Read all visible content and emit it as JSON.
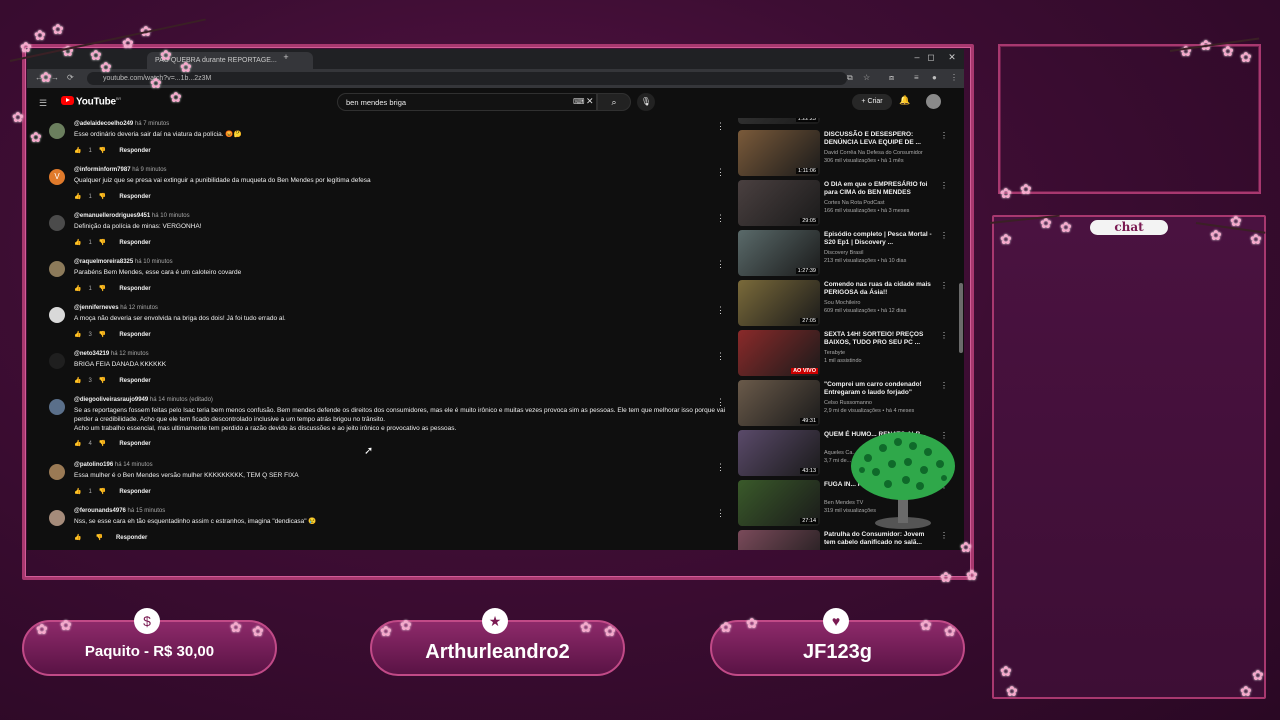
{
  "browser": {
    "tabs": [
      {
        "label": "PAU QUEBRA durante REPORTAGE..."
      }
    ],
    "new_tab": "+",
    "url": "youtube.com/watch?v=...1b...2z3M",
    "window_controls": [
      "–",
      "◻",
      "✕"
    ]
  },
  "youtube": {
    "logo": "YouTube",
    "logo_sup": "BR",
    "search_value": "ben mendes briga",
    "create_label": "Criar"
  },
  "comments": [
    {
      "user": "@adelaidecoelho249",
      "time": "há 7 minutos",
      "text": "Esse ordinário deveria sair daí na viatura da polícia. 😡🤔",
      "likes": "1",
      "avatar_color": "#6b7f5e"
    },
    {
      "user": "@informinform7987",
      "time": "há 9 minutos",
      "text": "Qualquer juiz que se presa vai extinguir a punibilidade da muqueta do Ben Mendes por legítima defesa",
      "likes": "1",
      "avatar_color": "#e07a2b",
      "avatar_letter": "V"
    },
    {
      "user": "@emanuellerodrigues9451",
      "time": "há 10 minutos",
      "text": "Definição da polícia de minas: VERGONHA!",
      "likes": "1",
      "avatar_color": "#4b4b4b"
    },
    {
      "user": "@raquelmoreira8325",
      "time": "há 10 minutos",
      "text": "Parabéns Bem Mendes, esse cara é um caloteiro covarde",
      "likes": "1",
      "avatar_color": "#8c7a5a"
    },
    {
      "user": "@jenniferneves",
      "time": "há 12 minutos",
      "text": "A moça não deveria ser envolvida na briga dos dois! Já foi tudo errado al.",
      "likes": "3",
      "avatar_color": "#d9d9d9"
    },
    {
      "user": "@neto34219",
      "time": "há 12 minutos",
      "text": "BRIGA FEIA DANADA KKKKKK",
      "likes": "3",
      "avatar_color": "#1f1f1f"
    },
    {
      "user": "@diegooliveirasraujo9949",
      "time": "há 14 minutos (editado)",
      "text": "Se as reportagens fossem feitas pelo Isac teria bem menos confusão. Bem mendes defende os direitos dos consumidores, mas ele é muito irônico e muitas vezes provoca sim as pessoas. Ele tem que melhorar isso porque vai perder a credibilidade. Acho que ele tem ficado descontrolado inclusive a um tempo atrás brigou no trânsito.\nAcho um trabalho essencial, mas ultimamente tem perdido a razão devido às discussões e ao jeito irônico e provocativo as pessoas.",
      "likes": "4",
      "avatar_color": "#5a6f8a"
    },
    {
      "user": "@patolino196",
      "time": "há 14 minutos",
      "text": "Essa mulher é o Ben Mendes versão mulher KKKKKKKKK, TEM Q SER FIXA",
      "likes": "1",
      "avatar_color": "#9a7a55"
    },
    {
      "user": "@ferounands4976",
      "time": "há 15 minutos",
      "text": "Nss, se esse cara eh tão esquentadinho assim c estranhos, imagina \"dendicasa\" 😢",
      "likes": "",
      "avatar_color": "#a58b7a"
    }
  ],
  "comment_reply_label": "Responder",
  "related": [
    {
      "title": "",
      "channel": "",
      "views": "",
      "duration": "1:22:23",
      "thumb_color": "#3a3a3a"
    },
    {
      "title": "DISCUSSÃO E DESESPERO: DENÚNCIA LEVA EQUIPE DE ...",
      "channel": "David Corrêa Na Defesa do Consumidor",
      "views": "306 mil visualizações • há 1 mês",
      "duration": "1:11:06",
      "thumb_color": "#7a5a3a"
    },
    {
      "title": "O DIA em que o EMPRESÁRIO foi para CIMA do BEN MENDES",
      "channel": "Cortes Na Rota PodCast",
      "views": "166 mil visualizações • há 3 meses",
      "duration": "29:05",
      "thumb_color": "#4a4040"
    },
    {
      "title": "Episódio completo | Pesca Mortal - S20 Ep1 | Discovery ...",
      "channel": "Discovery Brasil",
      "views": "213 mil visualizações • há 10 dias",
      "duration": "1:27:39",
      "thumb_color": "#5a6a6a"
    },
    {
      "title": "Comendo nas ruas da cidade mais PERIGOSA da Ásia!!",
      "channel": "Sou Mochileiro",
      "views": "609 mil visualizações • há 12 dias",
      "duration": "27:05",
      "thumb_color": "#7a6a3a"
    },
    {
      "title": "SEXTA 14H! SORTEIO! PREÇOS BAIXOS, TUDO PRO SEU PC ...",
      "channel": "Terabyte",
      "views": "1 mil assistindo",
      "live": "AO VIVO",
      "thumb_color": "#8a2a2a"
    },
    {
      "title": "\"Comprei um carro condenado! Entregaram o laudo forjado\"",
      "channel": "Celso Russomanno",
      "views": "2,9 mi de visualizações • há 4 meses",
      "duration": "49:31",
      "thumb_color": "#6a5a4a"
    },
    {
      "title": "QUEM É HUMO... RENATO ALB...",
      "channel": "Aqueles Ca...",
      "views": "3,7 mi de...",
      "duration": "43:13",
      "thumb_color": "#5a4a6a"
    },
    {
      "title": "FUGA IN... REPORTAL...",
      "channel": "Ben Mendes TV",
      "views": "319 mil visualizações",
      "duration": "27:14",
      "thumb_color": "#3a5a2a"
    },
    {
      "title": "Patrulha do Consumidor: Jovem tem cabelo danificado no salã...",
      "channel": "",
      "views": "",
      "duration": "",
      "thumb_color": "#7a4a5a"
    }
  ],
  "overlay": {
    "chat_label": "chat",
    "pills": [
      {
        "text": "Paquito - R$ 30,00",
        "icon": "$"
      },
      {
        "text": "Arthurleandro2",
        "icon": "★"
      },
      {
        "text": "JF123g",
        "icon": "♥"
      }
    ]
  },
  "colors": {
    "background": "#3d0d33",
    "frame": "#a8386f",
    "youtube_red": "#ff0000",
    "pill": "#8e2a6a"
  }
}
